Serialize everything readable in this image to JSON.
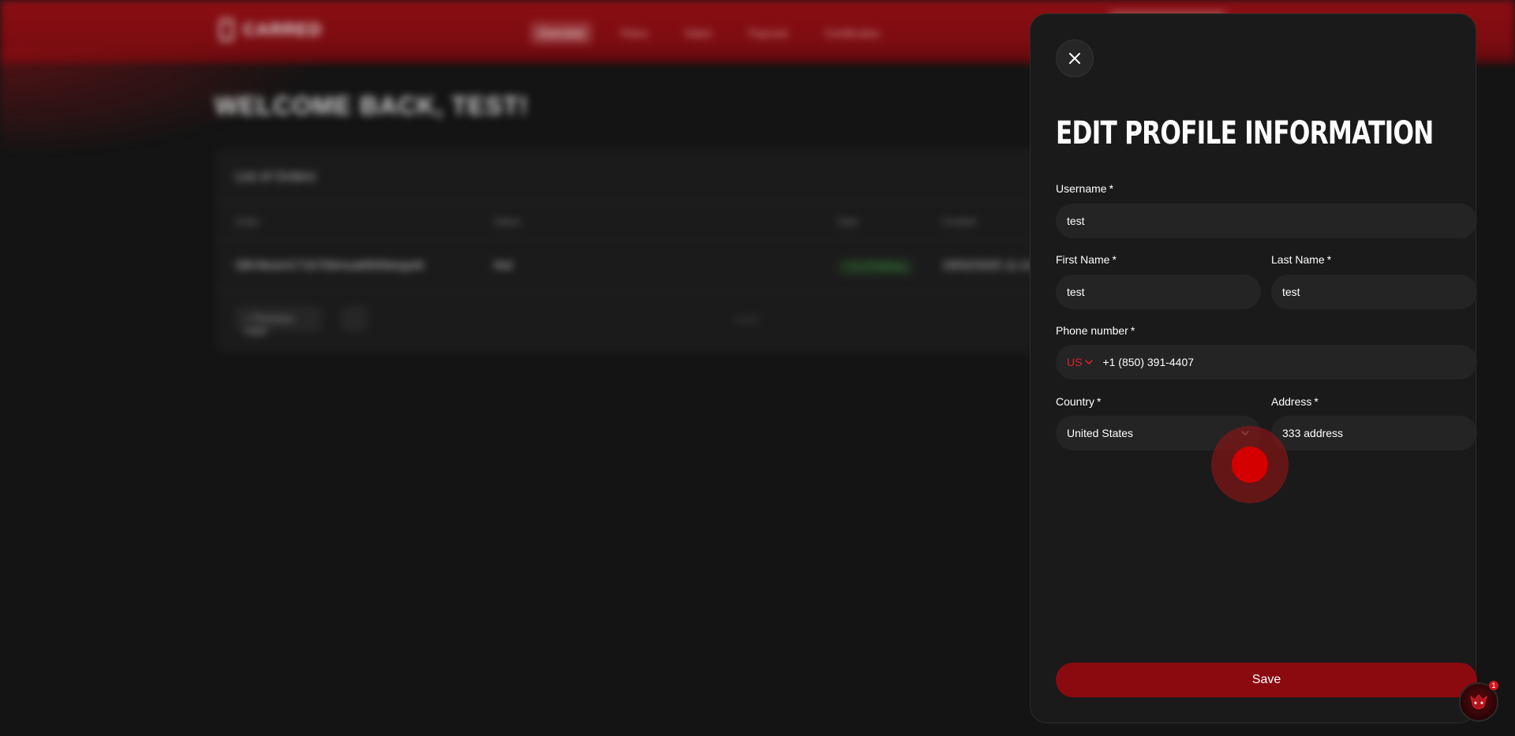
{
  "background": {
    "logo_text": "CARRED",
    "nav": [
      "Overview",
      "Plans",
      "Sales",
      "Payouts",
      "Certificates"
    ],
    "welcome": "WELCOME BACK, TEST!",
    "card_title": "List of Orders",
    "columns": [
      "Order",
      "Status",
      "Date",
      "Created"
    ],
    "row": {
      "order": "SBVMuenC71k7Dkmua6tNhbeqyeb",
      "status": "Not",
      "badge": "+TUTORIAL",
      "created": "19/02/2025 11:14"
    },
    "pager_label": "< Previous page",
    "pager_count": "1 of 1"
  },
  "panel": {
    "title": "EDIT PROFILE INFORMATION",
    "required_mark": "*",
    "username": {
      "label": "Username",
      "value": "test"
    },
    "first_name": {
      "label": "First Name",
      "value": "test"
    },
    "last_name": {
      "label": "Last Name",
      "value": "test"
    },
    "phone": {
      "label": "Phone number",
      "country_code": "US",
      "value": "+1 (850) 391-4407"
    },
    "country": {
      "label": "Country",
      "value": "United States"
    },
    "address": {
      "label": "Address",
      "value": "333 address"
    },
    "save_label": "Save"
  },
  "helper": {
    "badge_count": "1"
  },
  "colors": {
    "accent": "#8a0a0f",
    "accent_text": "#e0222a",
    "panel_bg": "#1a1a1a",
    "input_bg": "#242424"
  }
}
